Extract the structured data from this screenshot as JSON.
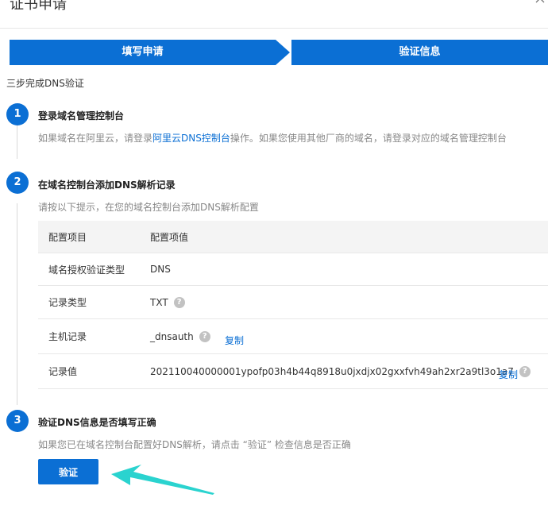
{
  "dialog": {
    "title": "证书申请"
  },
  "steps": {
    "step1_label": "填写申请",
    "step2_label": "验证信息"
  },
  "intro": "三步完成DNS验证",
  "step_one": {
    "number": "1",
    "title": "登录域名管理控制台",
    "desc_before": "如果域名在阿里云，请登录",
    "desc_link": "阿里云DNS控制台",
    "desc_after": "操作。如果您使用其他厂商的域名，请登录对应的域名管理控制台"
  },
  "step_two": {
    "number": "2",
    "title": "在域名控制台添加DNS解析记录",
    "desc": "请按以下提示，在您的域名控制台添加DNS解析配置"
  },
  "table": {
    "header_key": "配置项目",
    "header_value": "配置项值",
    "rows": [
      {
        "key": "域名授权验证类型",
        "value": "DNS"
      },
      {
        "key": "记录类型",
        "value": "TXT"
      },
      {
        "key": "主机记录",
        "value": "_dnsauth",
        "copy": "复制"
      },
      {
        "key": "记录值",
        "value": "202110040000001ypofp03h4b44q8918u0jxdjx02gxxfvh49ah2xr2a9tl3o1a7",
        "copy": "复制"
      }
    ],
    "help_glyph": "?"
  },
  "step_three": {
    "number": "3",
    "title": "验证DNS信息是否填写正确",
    "desc": "如果您已在域名控制台配置好DNS解析，请点击 “验证” 检查信息是否正确"
  },
  "verify_button": "验证",
  "colors": {
    "primary": "#0b6fd4",
    "annotation_arrow": "#2ad3cf"
  },
  "icons": {
    "close": "close-icon",
    "help": "help-icon",
    "pointer": "arrow-icon"
  }
}
